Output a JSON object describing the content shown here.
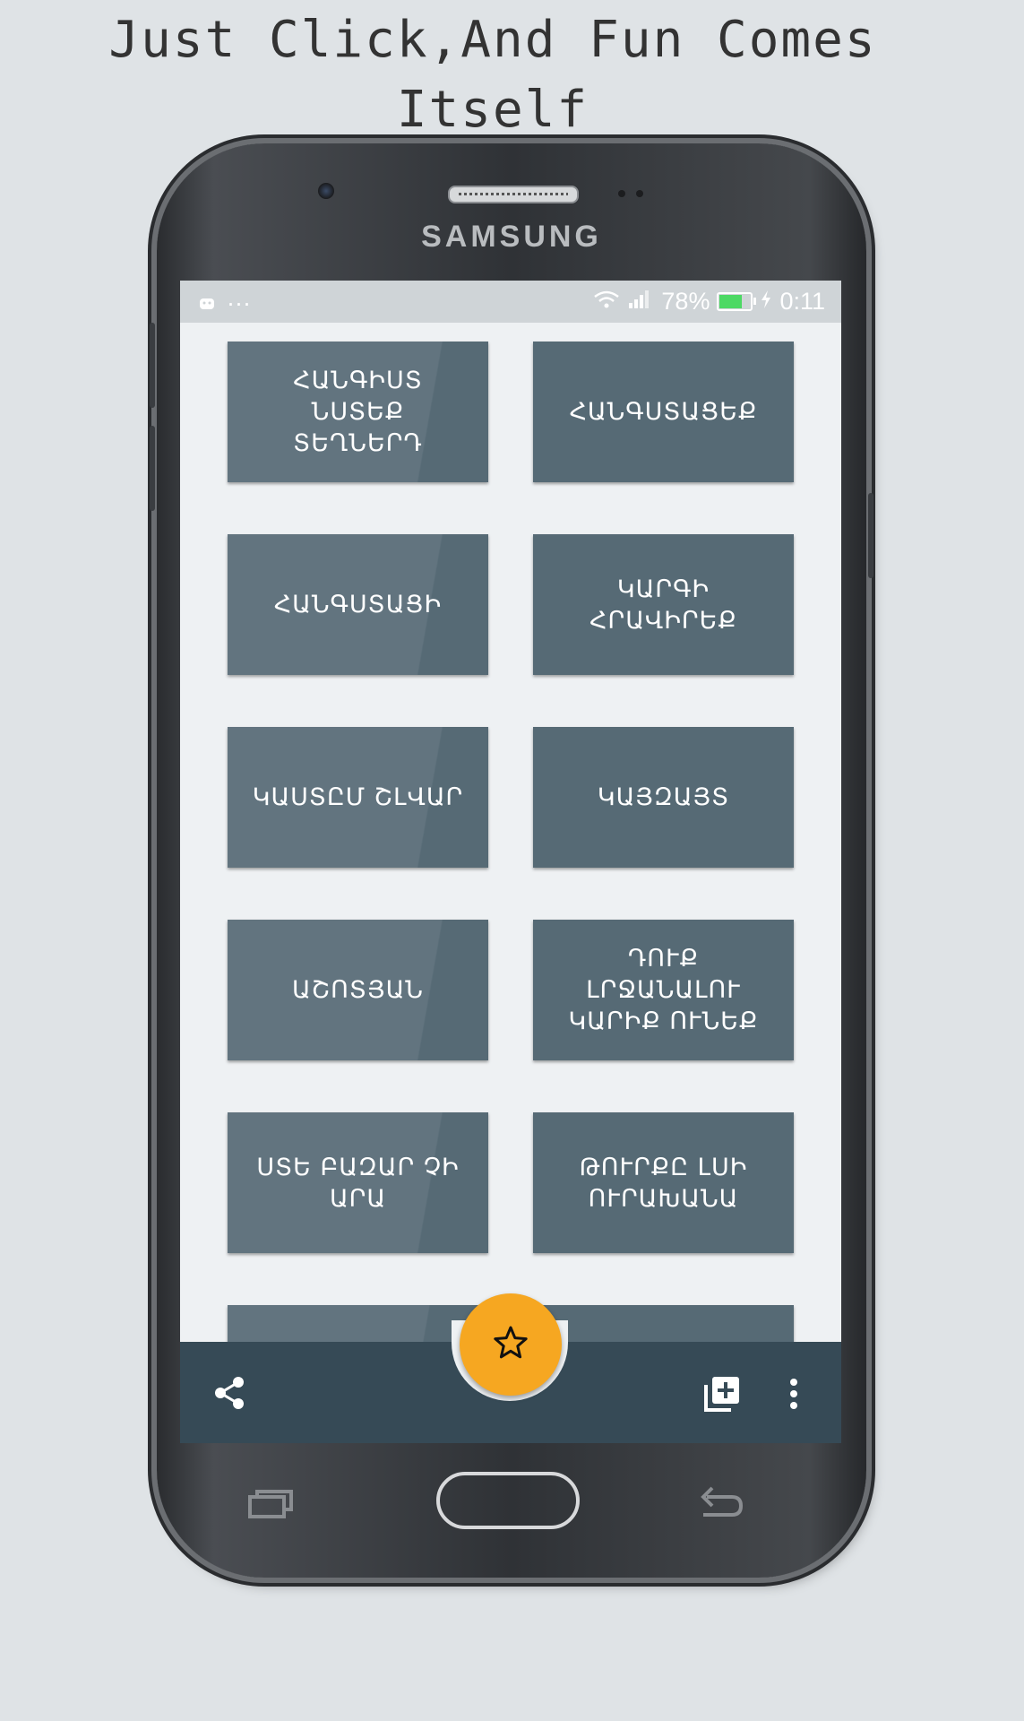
{
  "headline": "Just Click,And Fun Comes\nItself",
  "device": {
    "brand": "SAMSUNG"
  },
  "status_bar": {
    "left_dots": "···",
    "battery": "78%",
    "battery_level": 0.78,
    "time": "0:11"
  },
  "tiles": [
    {
      "label": "ՀԱՆԳԻՍՏ ՆՍՏԵՔ ՏԵՂՆԵՐԴ"
    },
    {
      "label": "ՀԱՆԳՍՏԱՑԵՔ"
    },
    {
      "label": "ՀԱՆԳՍՏԱՑԻ"
    },
    {
      "label": "ԿԱՐԳԻ ՀՐԱՎԻՐԵՔ"
    },
    {
      "label": "ԿԱՍՏԸՄ ՇԼՎԱՐ"
    },
    {
      "label": "ԿԱՅԶԱՅՏ"
    },
    {
      "label": "ԱՇՈՏՅԱՆ"
    },
    {
      "label": "ԴՈՒՔ ԼՐՋԱՆԱԼՈՒ ԿԱՐԻՔ ՈՒՆԵՔ"
    },
    {
      "label": "ՍՏԵ ԲԱԶԱՐ ՉԻ ԱՐԱ"
    },
    {
      "label": "ԹՈՒՐՔԸ ԼՍԻ ՈՒՐԱԽԱՆԱ"
    },
    {
      "label": ""
    },
    {
      "label": ""
    }
  ],
  "bottom_bar": {
    "share_icon": "share-icon",
    "favorite_icon": "star-icon",
    "add_icon": "library-add-icon",
    "more_icon": "more-vert-icon"
  },
  "colors": {
    "tile_left": "#62747f",
    "tile_right": "#566a75",
    "bottom_bar": "#364a56",
    "fab": "#f6a721",
    "background": "#dfe3e6"
  }
}
